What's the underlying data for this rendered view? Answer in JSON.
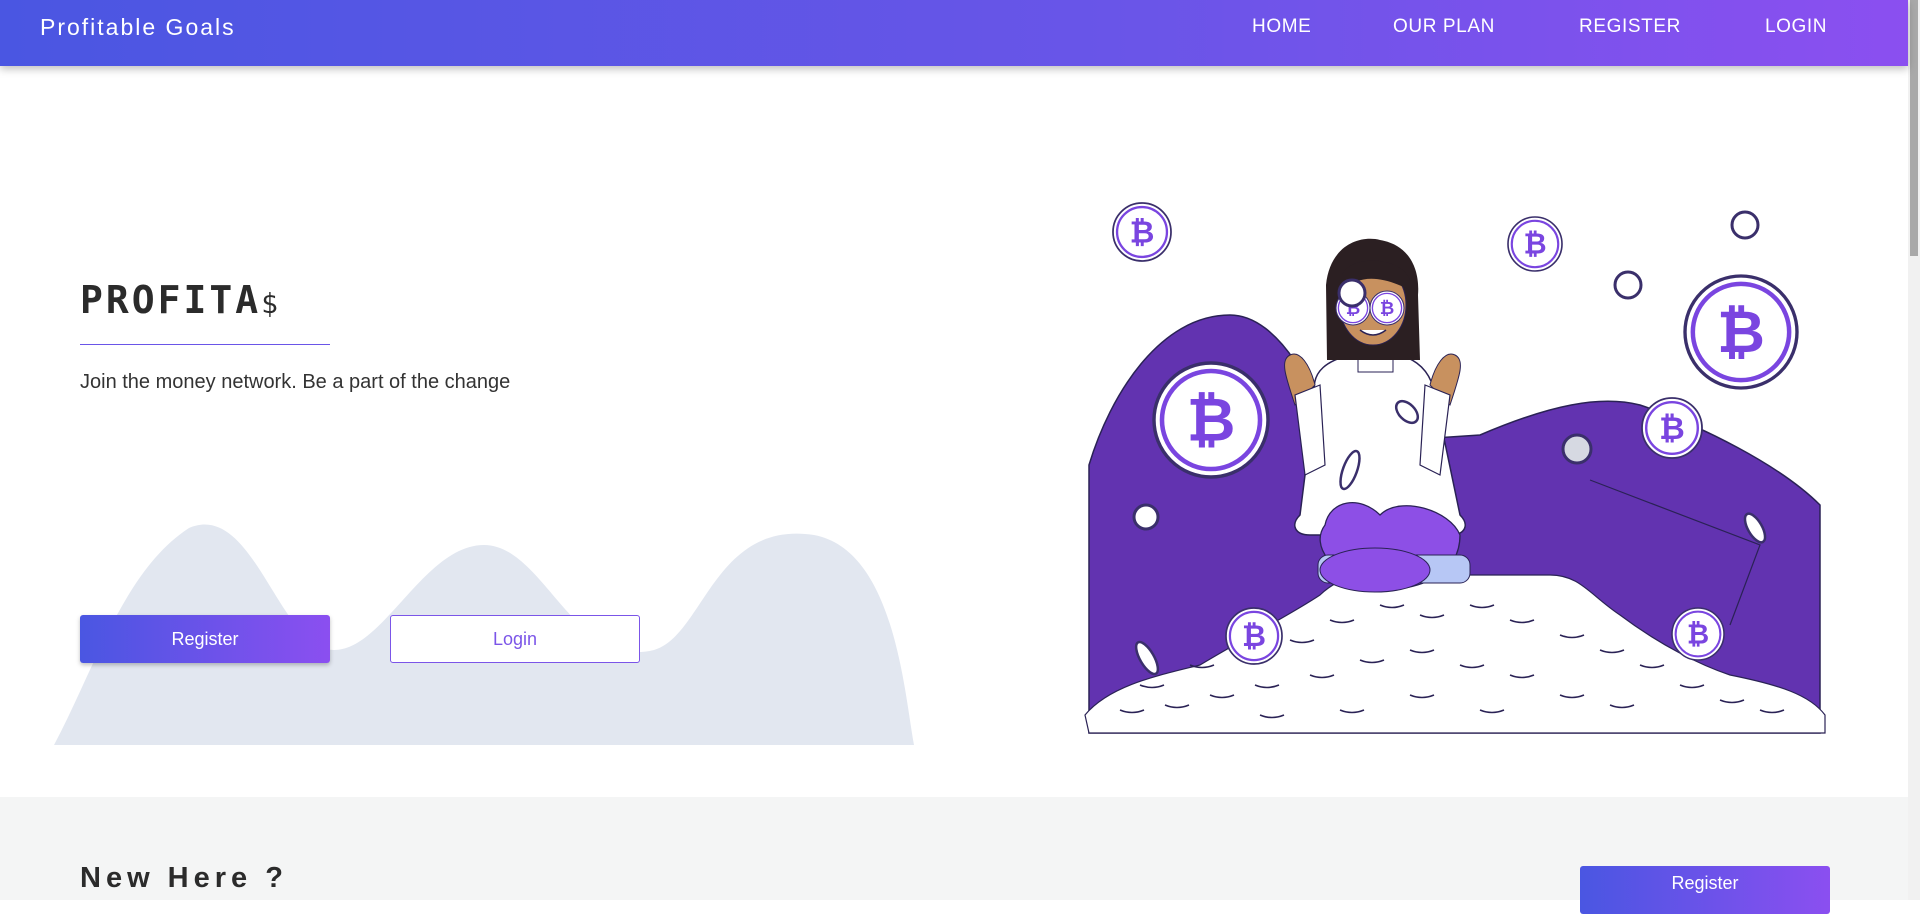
{
  "nav": {
    "brand": "Profitable Goals",
    "links": [
      "HOME",
      "OUR PLAN",
      "REGISTER",
      "LOGIN"
    ]
  },
  "hero": {
    "title": "PROFITA",
    "title_suffix": "$",
    "subtitle": "Join the money network. Be a part of the change",
    "register_label": "Register",
    "login_label": "Login"
  },
  "new_section": {
    "title": "New Here ?",
    "register_label": "Register"
  },
  "colors": {
    "gradient_start": "#4a56e2",
    "gradient_end": "#8b4ff0",
    "accent_purple": "#6a3ab0",
    "wave_fill": "#e2e7f0"
  }
}
